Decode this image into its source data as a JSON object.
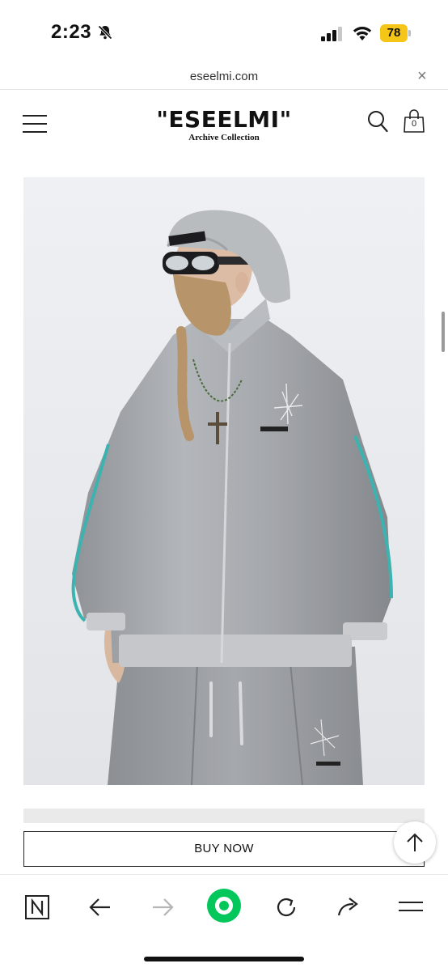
{
  "status_bar": {
    "time": "2:23",
    "battery": "78"
  },
  "browser": {
    "url": "eseelmi.com",
    "close_glyph": "×"
  },
  "header": {
    "brand": "\"ESEELMI\"",
    "subtitle": "Archive Collection",
    "cart_count": "0"
  },
  "product": {
    "buy_label": "BUY NOW"
  },
  "icons": {
    "bell": "bell-slash-icon",
    "signal": "cellular-signal-icon",
    "wifi": "wifi-icon",
    "menu": "hamburger-menu-icon",
    "search": "search-icon",
    "cart": "shopping-bag-icon",
    "scroll_top": "arrow-up-icon",
    "toolbar": [
      "naver-n-icon",
      "back-arrow-icon",
      "forward-arrow-icon",
      "green-home-icon",
      "reload-icon",
      "share-icon",
      "menu-lines-icon"
    ]
  },
  "colors": {
    "battery": "#f5c518",
    "accent_green": "#03c75a",
    "photo_bg": "#e9ebee"
  }
}
